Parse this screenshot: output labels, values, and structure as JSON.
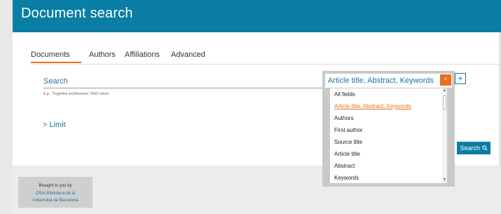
{
  "header": {
    "title": "Document search"
  },
  "tabs": [
    {
      "label": "Documents",
      "active": true
    },
    {
      "label": "Authors"
    },
    {
      "label": "Affiliations"
    },
    {
      "label": "Advanced"
    }
  ],
  "search": {
    "label": "Search",
    "hint": "E.g., \"Cognitive architectures\" AND robots",
    "limit_label": "> Limit",
    "button_label": "Search",
    "button_icon": "search-icon"
  },
  "field_select": {
    "selected": "Article title, Abstract, Keywords",
    "toggle_icon": "chevron-up-icon",
    "options": [
      "All fields",
      "Article title, Abstract, Keywords",
      "Authors",
      "First author",
      "Source title",
      "Article title",
      "Abstract",
      "Keywords"
    ],
    "selected_index": 1
  },
  "add_field": {
    "label": "+"
  },
  "footer": {
    "brought_by": "Brought to you by",
    "institution_line1": "CRAI Biblioteca de la",
    "institution_line2": "Universitat de Barcelona"
  },
  "colors": {
    "header_bg": "#0a7ea4",
    "accent_orange": "#e9711c",
    "link_blue": "#1a73a8"
  }
}
